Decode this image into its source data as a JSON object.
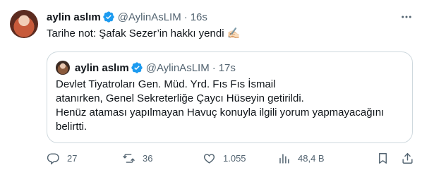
{
  "author": {
    "name": "aylin aslım",
    "handle": "@AylinAsLIM",
    "time": "16s",
    "separator": "·"
  },
  "tweet_text": "Tarihe not: Şafak Sezer’in hakkı yendi ✍🏻",
  "quote": {
    "name": "aylin aslım",
    "handle": "@AylinAsLIM",
    "time": "17s",
    "separator": "·",
    "lines": [
      "Devlet Tiyatroları Gen. Müd. Yrd. Fıs Fıs İsmail",
      "atanırken, Genel Sekreterliğe Çaycı Hüseyin getirildi.",
      "Henüz ataması yapılmayan Havuç konuyla ilgili yorum yapmayacağını",
      "belirtti."
    ]
  },
  "actions": {
    "replies": "27",
    "retweets": "36",
    "likes": "1.055",
    "views": "48,4 B"
  },
  "colors": {
    "text": "#0f1419",
    "secondary": "#536471",
    "verified": "#1d9bf0",
    "border": "#cfd9de"
  },
  "icons": [
    "verified-badge-icon",
    "more-icon",
    "reply-icon",
    "retweet-icon",
    "like-icon",
    "views-icon",
    "bookmark-icon",
    "share-icon"
  ]
}
